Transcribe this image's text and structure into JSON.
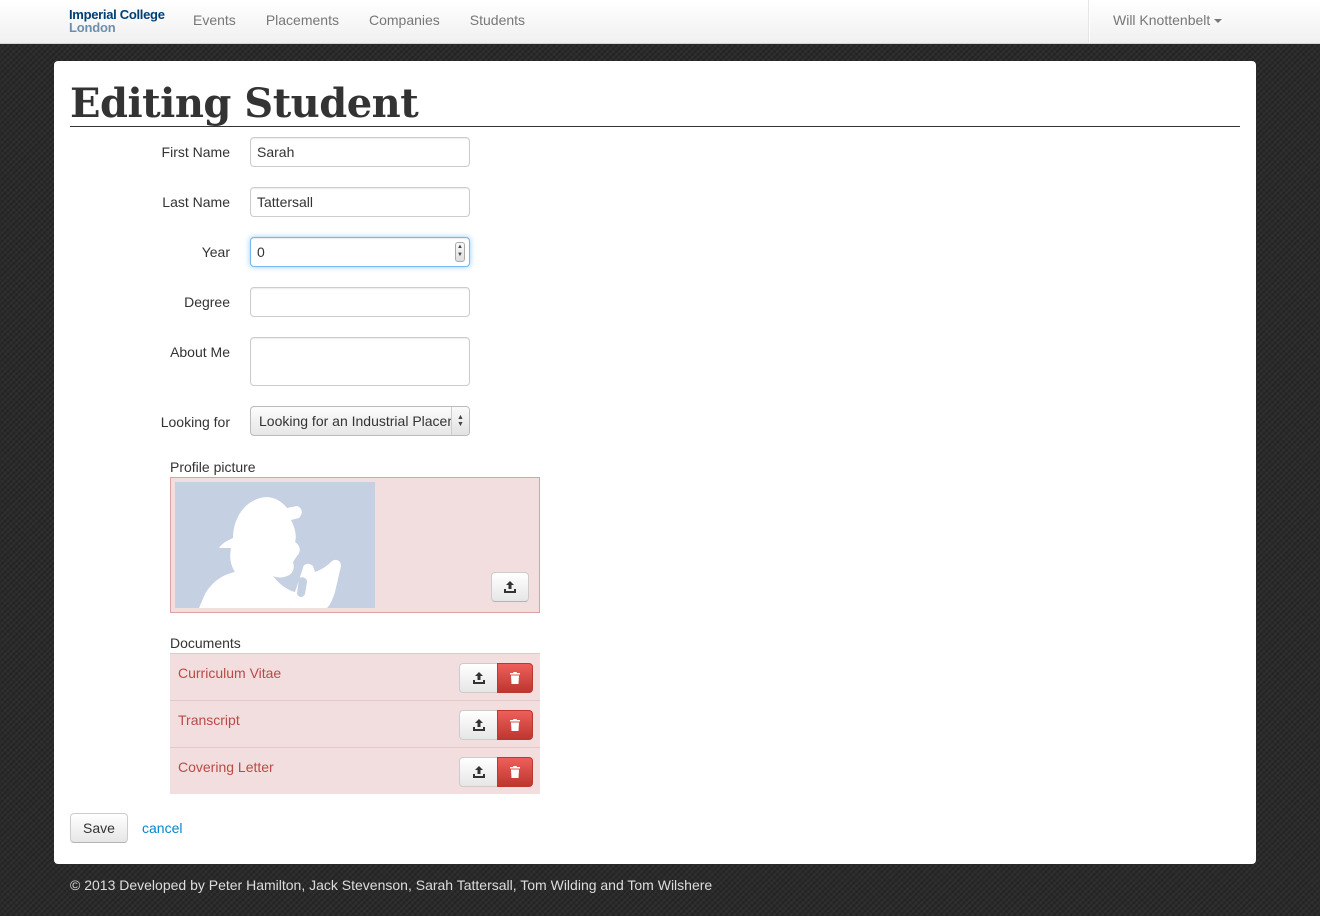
{
  "navbar": {
    "brand_line1": "Imperial College",
    "brand_line2": "London",
    "links": [
      "Events",
      "Placements",
      "Companies",
      "Students"
    ],
    "user": "Will Knottenbelt"
  },
  "page": {
    "title": "Editing Student"
  },
  "form": {
    "first_name": {
      "label": "First Name",
      "value": "Sarah"
    },
    "last_name": {
      "label": "Last Name",
      "value": "Tattersall"
    },
    "year": {
      "label": "Year",
      "value": "0"
    },
    "degree": {
      "label": "Degree",
      "value": ""
    },
    "about_me": {
      "label": "About Me",
      "value": ""
    },
    "looking_for": {
      "label": "Looking for",
      "selected": "Looking for an Industrial Placement"
    },
    "profile_picture_label": "Profile picture",
    "documents_label": "Documents",
    "documents": [
      "Curriculum Vitae",
      "Transcript",
      "Covering Letter"
    ],
    "save_label": "Save",
    "cancel_label": "cancel"
  },
  "footer": {
    "text": "© 2013 Developed by Peter Hamilton, Jack Stevenson, Sarah Tattersall, Tom Wilding and Tom Wilshere"
  },
  "icons": {
    "upload": "upload-icon",
    "delete": "trash-icon",
    "caret": "caret-down-icon"
  },
  "colors": {
    "error_bg": "#f2dede",
    "error_text": "#b94a48",
    "danger": "#da4f49",
    "link": "#0088cc",
    "brand": "#003e74"
  }
}
